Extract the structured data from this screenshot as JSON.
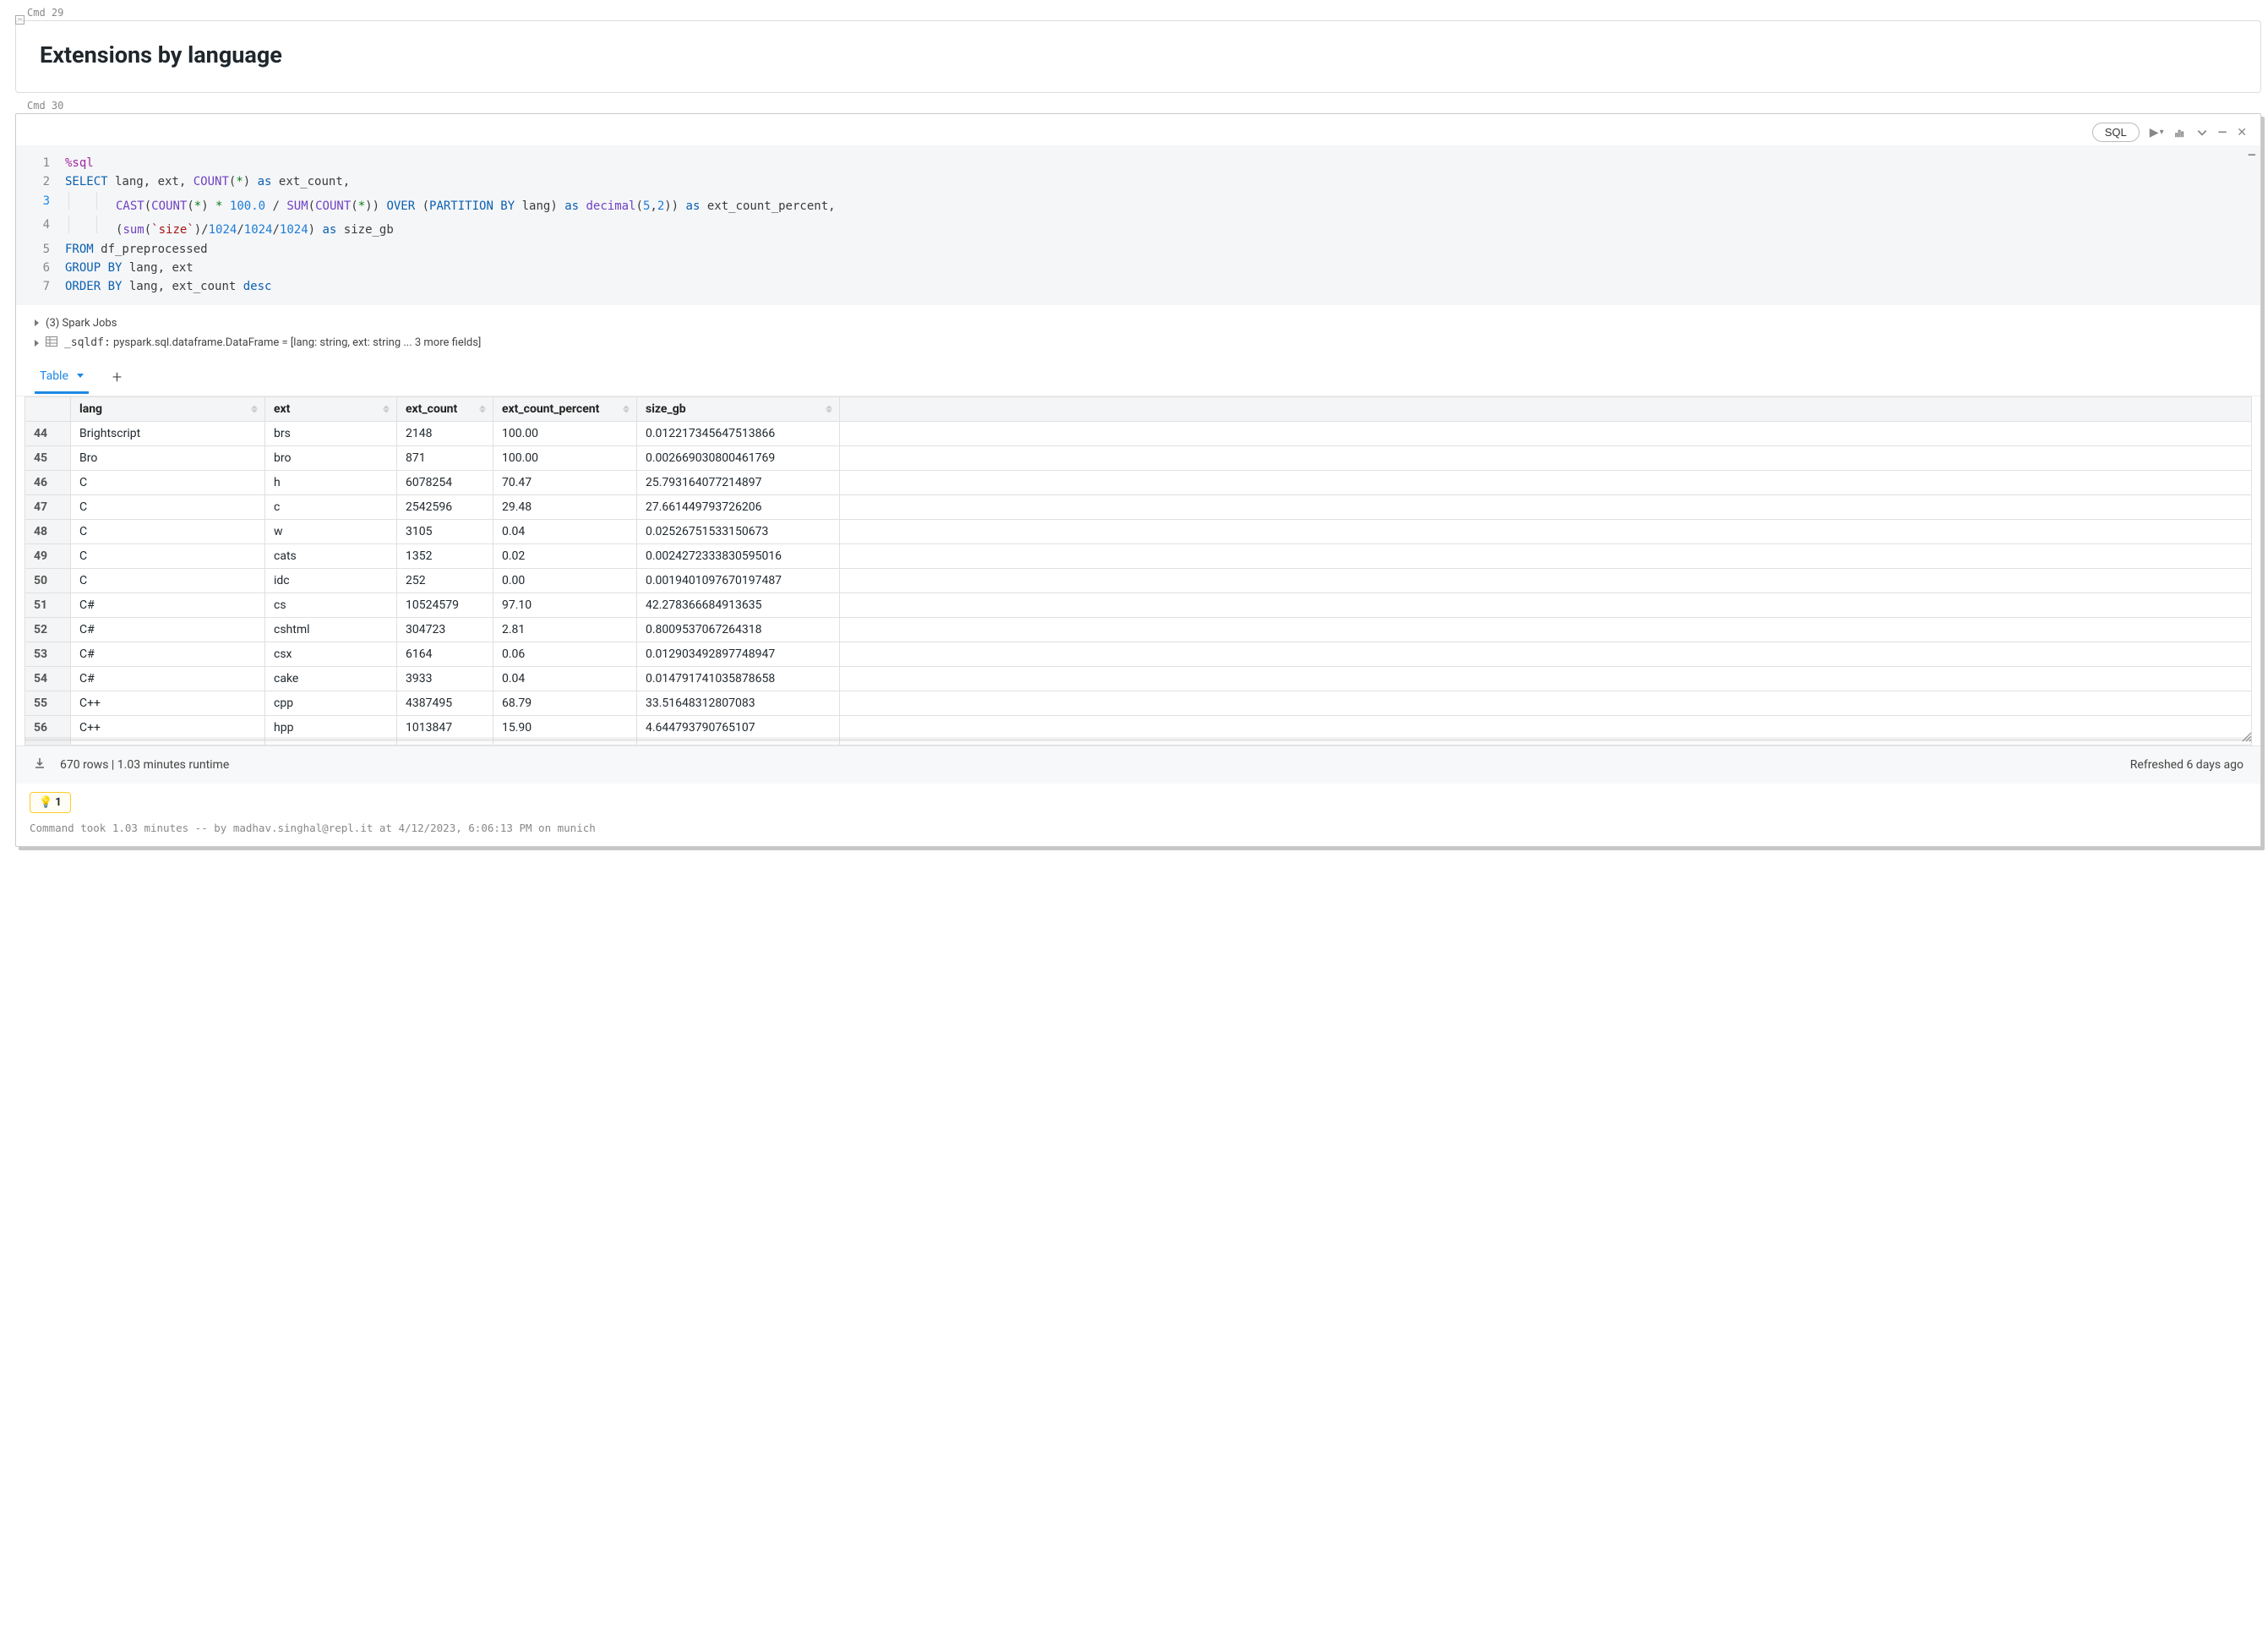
{
  "cells": {
    "cmd29_label": "Cmd 29",
    "cmd30_label": "Cmd 30",
    "heading": "Extensions by language"
  },
  "toolbar": {
    "sql_btn": "SQL"
  },
  "code": {
    "lines": [
      "%sql",
      "SELECT lang, ext, COUNT(*) as ext_count,",
      "       CAST(COUNT(*) * 100.0 / SUM(COUNT(*)) OVER (PARTITION BY lang) as decimal(5,2)) as ext_count_percent,",
      "       (sum(`size`)/1024/1024/1024) as size_gb",
      "FROM df_preprocessed",
      "GROUP BY lang, ext",
      "ORDER BY lang, ext_count desc"
    ]
  },
  "meta": {
    "spark_jobs": "(3) Spark Jobs",
    "sqldf_label": "_sqldf:",
    "sqldf_val": " pyspark.sql.dataframe.DataFrame = [lang: string, ext: string ... 3 more fields]"
  },
  "tabs": {
    "table": "Table"
  },
  "table": {
    "columns": [
      "lang",
      "ext",
      "ext_count",
      "ext_count_percent",
      "size_gb"
    ],
    "start_index": 44,
    "rows": [
      {
        "lang": "Brightscript",
        "ext": "brs",
        "ext_count": "2148",
        "ext_count_percent": "100.00",
        "size_gb": "0.012217345647513866"
      },
      {
        "lang": "Bro",
        "ext": "bro",
        "ext_count": "871",
        "ext_count_percent": "100.00",
        "size_gb": "0.002669030800461769"
      },
      {
        "lang": "C",
        "ext": "h",
        "ext_count": "6078254",
        "ext_count_percent": "70.47",
        "size_gb": "25.793164077214897"
      },
      {
        "lang": "C",
        "ext": "c",
        "ext_count": "2542596",
        "ext_count_percent": "29.48",
        "size_gb": "27.661449793726206"
      },
      {
        "lang": "C",
        "ext": "w",
        "ext_count": "3105",
        "ext_count_percent": "0.04",
        "size_gb": "0.02526751533150673"
      },
      {
        "lang": "C",
        "ext": "cats",
        "ext_count": "1352",
        "ext_count_percent": "0.02",
        "size_gb": "0.0024272333830595016"
      },
      {
        "lang": "C",
        "ext": "idc",
        "ext_count": "252",
        "ext_count_percent": "0.00",
        "size_gb": "0.0019401097670197487"
      },
      {
        "lang": "C#",
        "ext": "cs",
        "ext_count": "10524579",
        "ext_count_percent": "97.10",
        "size_gb": "42.278366684913635"
      },
      {
        "lang": "C#",
        "ext": "cshtml",
        "ext_count": "304723",
        "ext_count_percent": "2.81",
        "size_gb": "0.8009537067264318"
      },
      {
        "lang": "C#",
        "ext": "csx",
        "ext_count": "6164",
        "ext_count_percent": "0.06",
        "size_gb": "0.012903492897748947"
      },
      {
        "lang": "C#",
        "ext": "cake",
        "ext_count": "3933",
        "ext_count_percent": "0.04",
        "size_gb": "0.014791741035878658"
      },
      {
        "lang": "C++",
        "ext": "cpp",
        "ext_count": "4387495",
        "ext_count_percent": "68.79",
        "size_gb": "33.51648312807083"
      },
      {
        "lang": "C++",
        "ext": "hpp",
        "ext_count": "1013847",
        "ext_count_percent": "15.90",
        "size_gb": "4.644793790765107"
      }
    ]
  },
  "footer": {
    "rows_runtime": "670 rows  |  1.03 minutes runtime",
    "refreshed": "Refreshed 6 days ago",
    "lightbulb_count": "1",
    "status": "Command took 1.03 minutes -- by madhav.singhal@repl.it at 4/12/2023, 6:06:13 PM on munich"
  }
}
